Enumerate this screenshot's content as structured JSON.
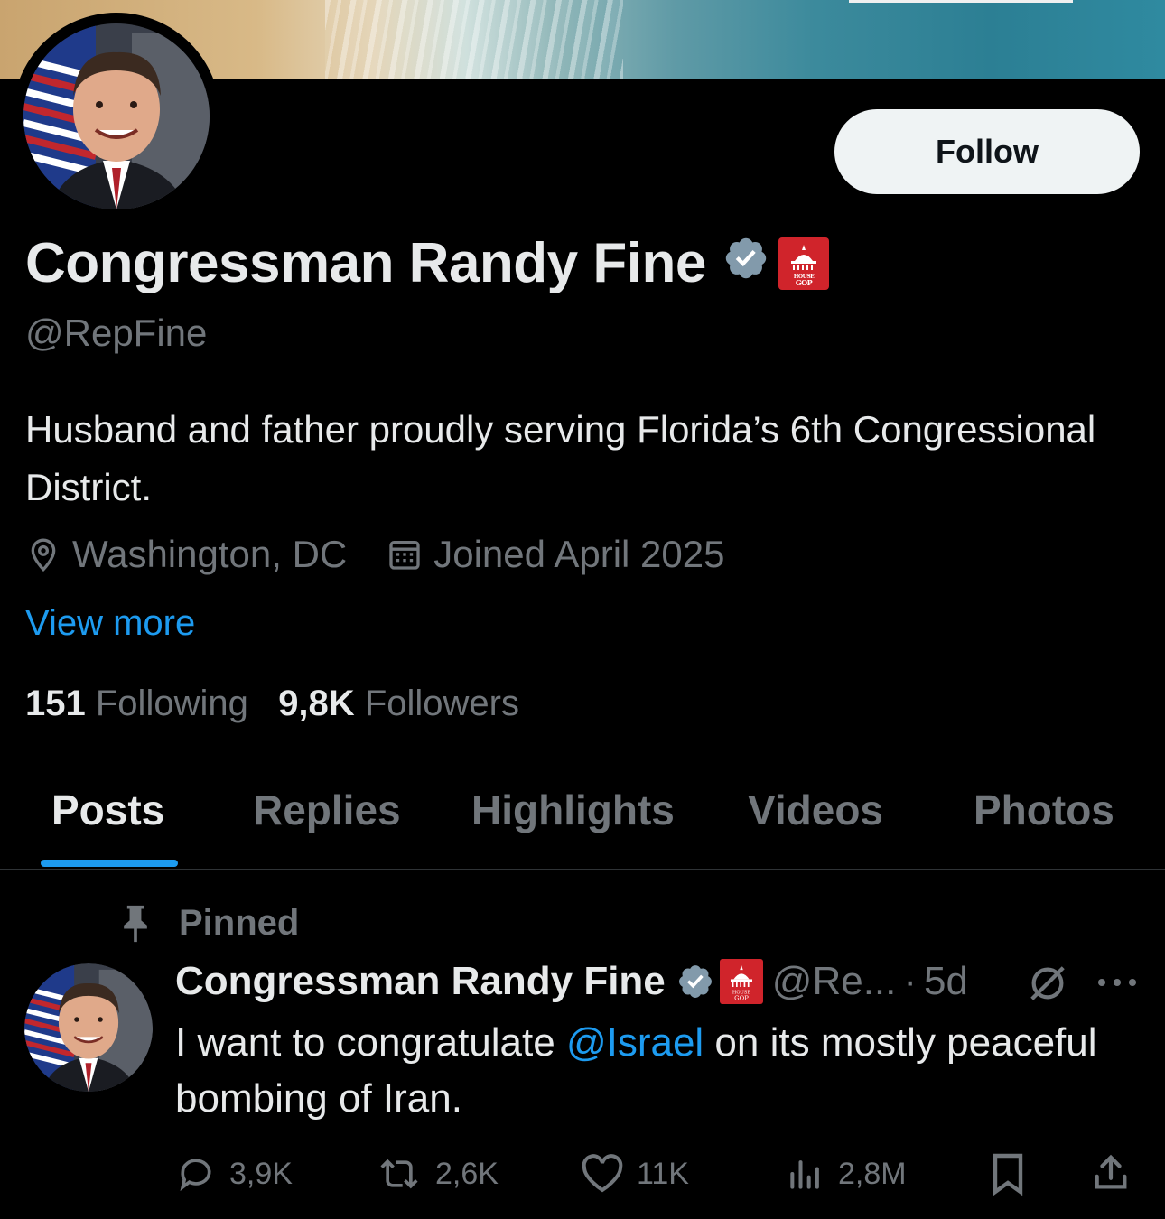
{
  "header": {
    "follow_label": "Follow"
  },
  "profile": {
    "name": "Congressman Randy Fine",
    "handle": "@RepFine",
    "bio": "Husband and father proudly serving Florida’s 6th Congressional District.",
    "location": "Washington, DC",
    "joined": "Joined April 2025",
    "view_more": "View more",
    "following_count": "151",
    "following_label": "Following",
    "followers_count": "9,8K",
    "followers_label": "Followers"
  },
  "badges": {
    "gop_text_top": "HOUSE",
    "gop_text_bottom": "GOP"
  },
  "tabs": [
    {
      "label": "Posts",
      "active": true
    },
    {
      "label": "Replies"
    },
    {
      "label": "Highlights"
    },
    {
      "label": "Videos"
    },
    {
      "label": "Photos"
    }
  ],
  "post": {
    "pinned_label": "Pinned",
    "author_name": "Congressman Randy Fine",
    "author_handle": "@Re...",
    "separator": "·",
    "time": "5d",
    "text_before": "I want to congratulate ",
    "mention": "@Israel",
    "text_after": " on its mostly peaceful bombing of Iran.",
    "replies": "3,9K",
    "reposts": "2,6K",
    "likes": "11K",
    "views": "2,8M"
  },
  "colors": {
    "accent": "#1d9bf0",
    "background": "#000000",
    "text_primary": "#e7e9ea",
    "text_secondary": "#71767b",
    "gop_red": "#d0242b"
  }
}
